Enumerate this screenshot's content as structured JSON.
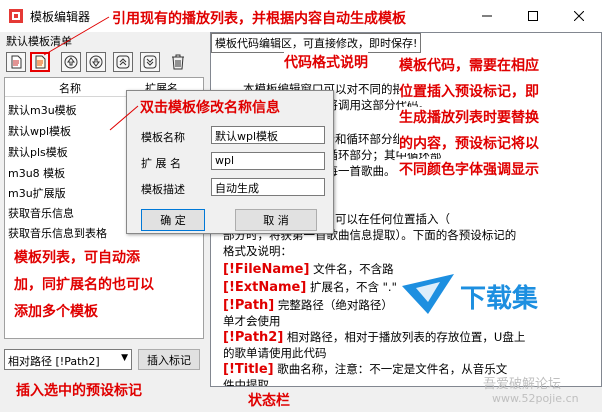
{
  "window": {
    "title": "模板编辑器",
    "minimize_icon": "minimize-icon",
    "maximize_icon": "maximize-icon",
    "close_icon": "close-icon"
  },
  "left_panel": {
    "section_label": "默认模板清单",
    "toolbar": [
      {
        "name": "new-template-button",
        "icon": "new-file-icon",
        "glyph": "🗋"
      },
      {
        "name": "create-from-playlist-button",
        "icon": "playlist-file-icon",
        "glyph": "📄"
      },
      {
        "name": "move-up-button",
        "icon": "arrow-up-icon",
        "glyph": "⇧"
      },
      {
        "name": "move-down-button",
        "icon": "arrow-down-icon",
        "glyph": "⇩"
      },
      {
        "name": "move-top-button",
        "icon": "double-arrow-up-icon",
        "glyph": "⤒"
      },
      {
        "name": "move-bottom-button",
        "icon": "double-arrow-down-icon",
        "glyph": "⤓"
      },
      {
        "name": "delete-button",
        "icon": "trash-icon",
        "glyph": "🗑"
      }
    ],
    "list_columns": [
      "名称",
      "扩展名"
    ],
    "templates": [
      "默认m3u模板",
      "默认wpl模板",
      "默认pls模板",
      "m3u8 模板",
      "m3u扩展版",
      "获取音乐信息",
      "获取音乐信息到表格"
    ],
    "tag_select_value": "相对路径 [!Path2]",
    "insert_button": "插入标记"
  },
  "editor": {
    "label": "模板代码编辑区，可直接修改，即时保存!",
    "lines": [
      {
        "text": "本模板编辑窗口可以对不同的播放列表模板进行编",
        "tag": ""
      },
      {
        "text": "辑，生成播放列表时将调用这部分代码。",
        "tag": ""
      },
      {
        "text": "",
        "tag": ""
      },
      {
        "text": "模板代码由各部分和循环部分组成，一般",
        "tag": ""
      },
      {
        "text": "包括头部和歌曲信息循环部分；其中循环部",
        "tag": ""
      },
      {
        "text": "分对应播放列表中的每一首歌曲。",
        "tag": ""
      },
      {
        "text": "",
        "tag": ""
      },
      {
        "text": "插入预设的代码，可以在任何位置插入（",
        "tag": ""
      },
      {
        "text": "部分时，将获第一首歌曲信息提取）。下面的各预设标记的",
        "tag": ""
      },
      {
        "text": "格式及说明：",
        "tag": ""
      },
      {
        "text": " 文件名，不含路",
        "tag": "[!FileName]"
      },
      {
        "text": " 扩展名，不含 \".\"",
        "tag": "[!ExtName]"
      },
      {
        "text": " 完整路径（绝对路径）",
        "tag": "[!Path]"
      },
      {
        "text": "单才会使用",
        "tag": ""
      },
      {
        "text": " 相对路径，相对于播放列表的存放位置，U盘上",
        "tag": "[!Path2]"
      },
      {
        "text": "的歌单请使用此代码",
        "tag": ""
      },
      {
        "text": " 歌曲名称，注意：不一定是文件名，从音乐文",
        "tag": "[!Title]"
      },
      {
        "text": "件中提取",
        "tag": ""
      }
    ]
  },
  "dialog": {
    "fields": [
      {
        "label": "模板名称",
        "value": "默认wpl模板"
      },
      {
        "label": "扩 展 名",
        "value": "wpl"
      },
      {
        "label": "模板描述",
        "value": "自动生成"
      }
    ],
    "ok_button": "确 定",
    "cancel_button": "取 消"
  },
  "annotations": {
    "playlist_template": "引用现有的播放列表，并根据内容自动生成模板",
    "code_format": "代码格式说明",
    "template_code": [
      "模板代码，需要在相应",
      "位置插入预设标记，即",
      "生成播放列表时要替换",
      "的内容，预设标记将以",
      "不同颜色字体强调显示"
    ],
    "rename": "双击模板修改名称信息",
    "list_desc": [
      "模板列表，可自动添",
      "加，同扩展名的也可以",
      "添加多个模板"
    ],
    "insert_tag": "插入选中的预设标记",
    "status_bar": "状态栏"
  },
  "watermark": {
    "logo_text": "下载集",
    "site1": "吾爱破解论坛",
    "site2": "www.52pojie.cn"
  },
  "colors": {
    "annotation": "#e00000",
    "logo_blue": "#1d8fe0"
  }
}
